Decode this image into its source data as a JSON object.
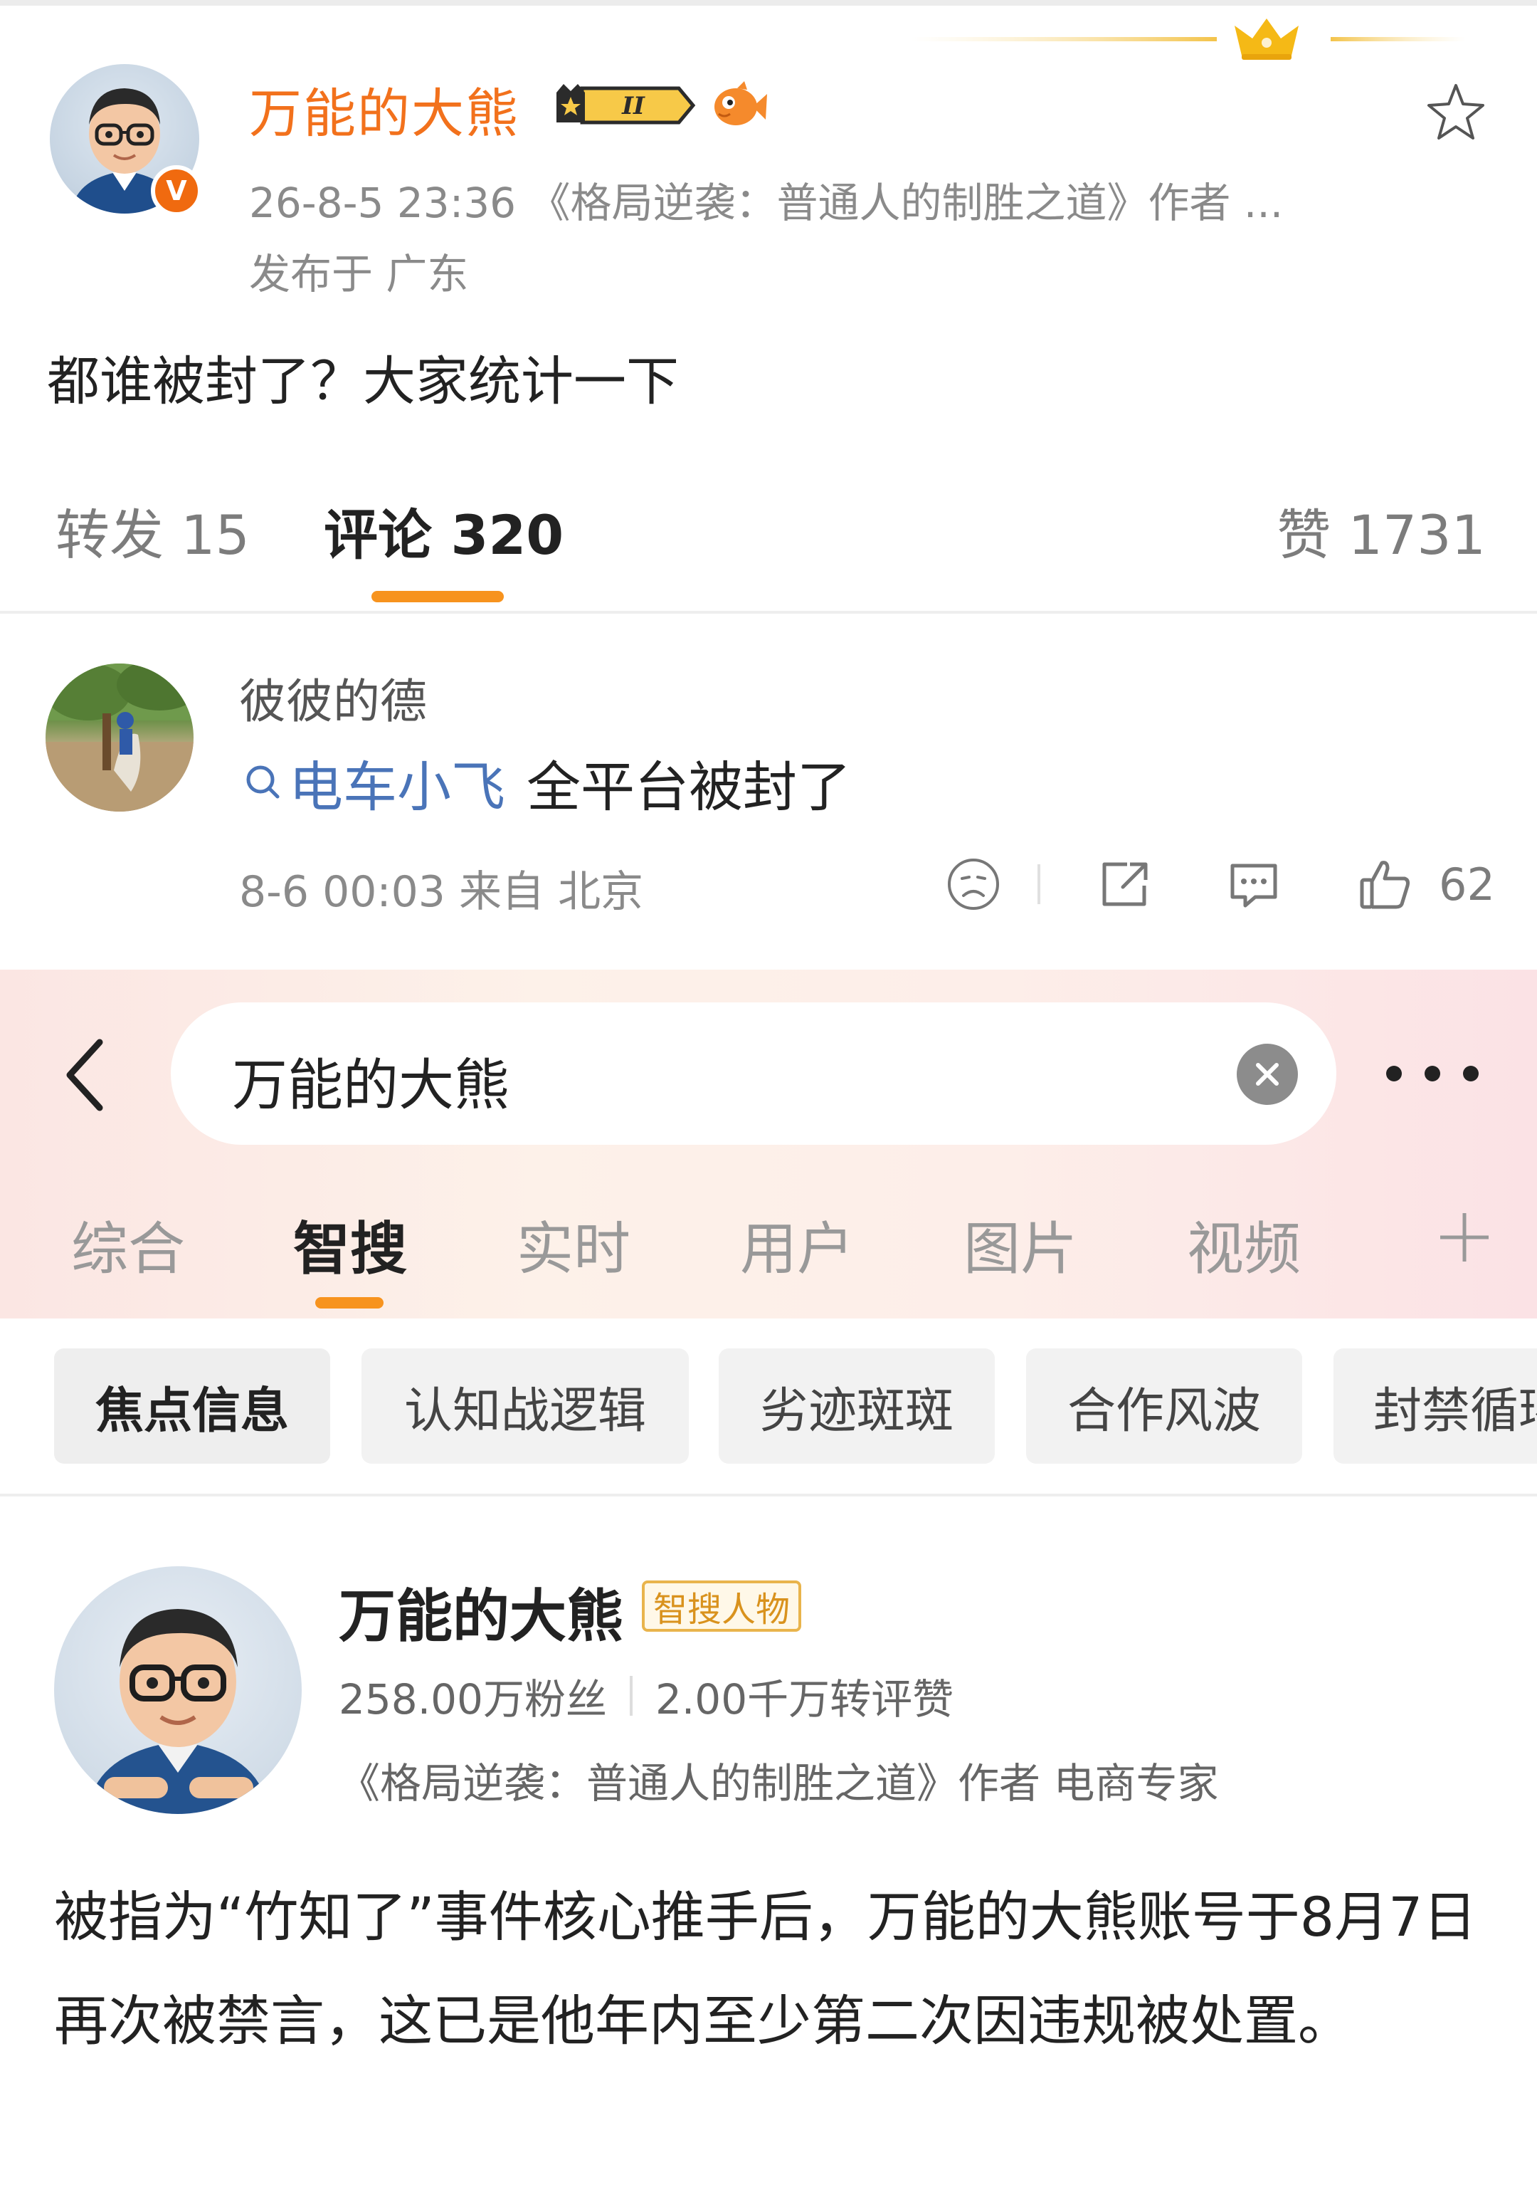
{
  "post": {
    "author": "万能的大熊",
    "meta": "26-8-5 23:36 《格局逆袭：普通人的制胜之道》作者 ...",
    "location": "发布于 广东",
    "text": "都谁被封了？大家统计一下",
    "vip_level": "II"
  },
  "tabs": {
    "repost": "转发 15",
    "comment": "评论 320",
    "like": "赞 1731"
  },
  "comment": {
    "author": "彼彼的德",
    "link_text": "电车小飞",
    "text": "全平台被封了",
    "meta": "8-6 00:03 来自 北京",
    "like_count": "62"
  },
  "search": {
    "query": "万能的大熊",
    "tabs": [
      "综合",
      "智搜",
      "实时",
      "用户",
      "图片",
      "视频"
    ],
    "chips": [
      "焦点信息",
      "认知战逻辑",
      "劣迹斑斑",
      "合作风波",
      "封禁循环"
    ]
  },
  "profile": {
    "name": "万能的大熊",
    "tag": "智搜人物",
    "followers": "258.00万粉丝",
    "interactions": "2.00千万转评赞",
    "description": "《格局逆袭：普通人的制胜之道》作者 电商专家"
  },
  "summary": "被指为“竹知了”事件核心推手后，万能的大熊账号于8月7日再次被禁言，这已是他年内至少第二次因违规被处置。",
  "colors": {
    "accent": "#f7931e",
    "username": "#f2711c",
    "link": "#4a74b8",
    "verified": "#f06a0f"
  },
  "icons": [
    "crown-icon",
    "verified-icon",
    "vip-badge-icon",
    "fish-icon",
    "star-icon",
    "search-icon",
    "sad-face-icon",
    "share-icon",
    "comment-icon",
    "thumbs-up-icon",
    "back-icon",
    "clear-icon",
    "more-icon",
    "plus-icon"
  ]
}
